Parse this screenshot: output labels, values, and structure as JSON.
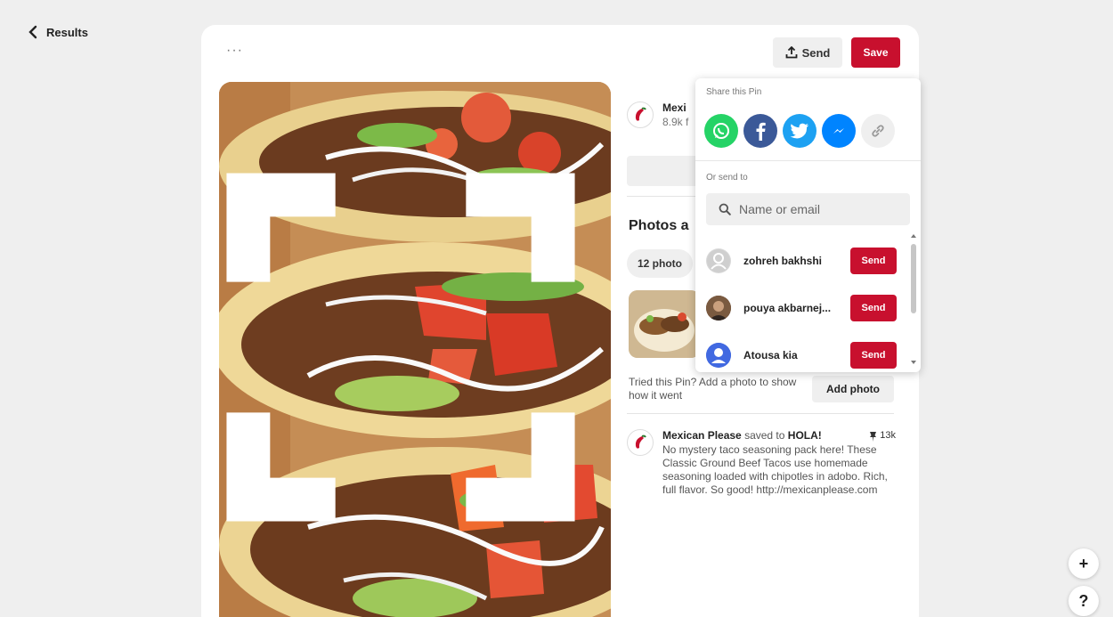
{
  "nav": {
    "back_label": "Results"
  },
  "toolbar": {
    "more_label": "···",
    "send_label": "Send",
    "save_label": "Save"
  },
  "creator": {
    "name": "Mexican Please",
    "name_visible": "Mexi",
    "followers": "8.9k f"
  },
  "photos_section": {
    "title": "Photos a",
    "count_label": "12 photo",
    "tried_text": "Tried this Pin? Add a photo to show how it went",
    "add_photo_label": "Add photo"
  },
  "activity": {
    "saver": "Mexican Please",
    "saved_to": "saved to",
    "board": "HOLA!",
    "pin_count": "13k",
    "description": "No mystery taco seasoning pack here! These Classic Ground Beef Tacos use homemade seasoning loaded with chipotles in adobo. Rich, full flavor. So good! http://mexicanplease.com"
  },
  "share": {
    "title": "Share this Pin",
    "networks": [
      {
        "name": "whatsapp",
        "color": "#25d366"
      },
      {
        "name": "facebook",
        "color": "#3b5998"
      },
      {
        "name": "twitter",
        "color": "#1da1f2"
      },
      {
        "name": "messenger",
        "color": "#0084ff"
      },
      {
        "name": "copy-link",
        "color": "#efefef"
      }
    ],
    "or_send_label": "Or send to",
    "search_placeholder": "Name or email",
    "contacts": [
      {
        "name": "zohreh bakhshi",
        "send_label": "Send"
      },
      {
        "name": "pouya akbarnej...",
        "send_label": "Send"
      },
      {
        "name": "Atousa kia",
        "send_label": "Send"
      }
    ]
  },
  "fabs": {
    "plus": "+",
    "help": "?"
  },
  "colors": {
    "accent": "#c8102e",
    "background": "#efefef"
  }
}
